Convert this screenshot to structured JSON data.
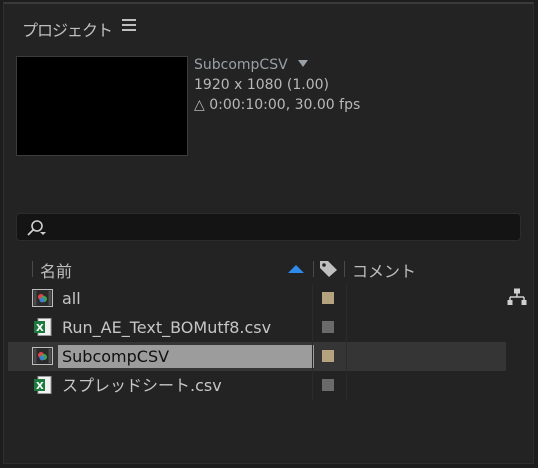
{
  "panel": {
    "title": "プロジェクト",
    "menu_icon": "hamburger-menu-icon"
  },
  "preview": {
    "comp_name": "SubcompCSV",
    "resolution": "1920 x 1080 (1.00)",
    "duration": "△ 0:00:10:00, 30.00 fps"
  },
  "search": {
    "icon": "search-icon",
    "value": ""
  },
  "columns": {
    "name": "名前",
    "comment": "コメント",
    "sort_direction": "ascending",
    "sort_color": "#2d8ceb"
  },
  "items": [
    {
      "name": "all",
      "type": "composition",
      "label_color": "#b5a27e"
    },
    {
      "name": "Run_AE_Text_BOMutf8.csv",
      "type": "csv",
      "label_color": "#6a6a6a"
    },
    {
      "name": "SubcompCSV",
      "type": "composition",
      "label_color": "#b5a27e",
      "selected": true
    },
    {
      "name": "スプレッドシート.csv",
      "type": "csv",
      "label_color": "#6a6a6a"
    }
  ],
  "side_icons": [
    "flowchart-icon"
  ]
}
